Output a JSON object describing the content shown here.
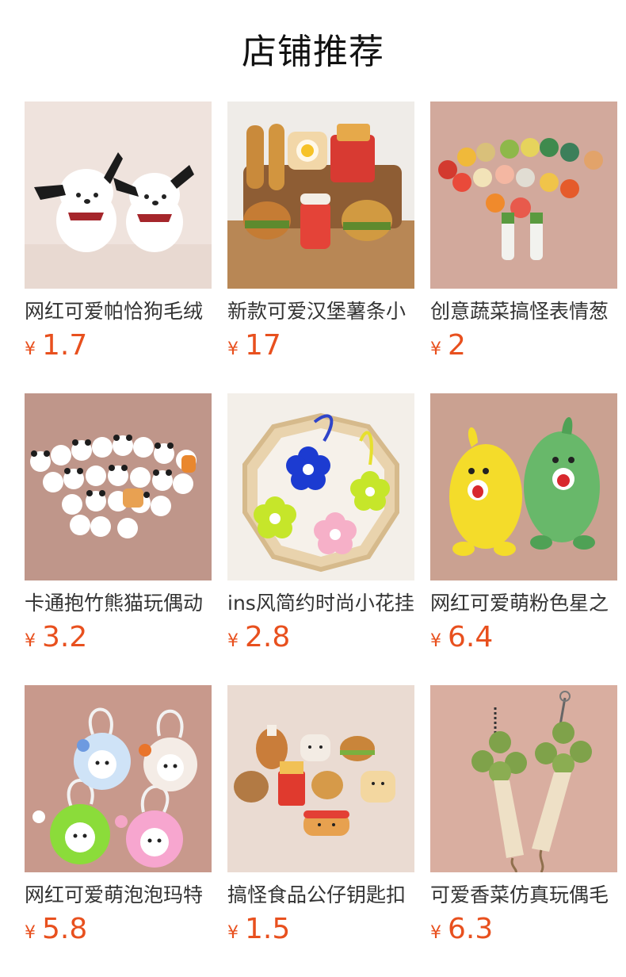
{
  "section": {
    "title": "店铺推荐"
  },
  "currency_symbol": "¥",
  "products": [
    {
      "name": "网红可爱帕恰狗毛绒",
      "price": "1.7",
      "bg": "#efe3dd",
      "image_icon": "plush-dog-pair-image"
    },
    {
      "name": "新款可爱汉堡薯条小",
      "price": "17",
      "bg": "#d9cbbd",
      "image_icon": "plush-food-bags-image"
    },
    {
      "name": "创意蔬菜搞怪表情葱",
      "price": "2",
      "bg": "#d2a99c",
      "image_icon": "plush-vegetable-keychains-image"
    },
    {
      "name": "卡通抱竹熊猫玩偶动",
      "price": "3.2",
      "bg": "#bf968a",
      "image_icon": "plush-panda-pile-image"
    },
    {
      "name": "ins风简约时尚小花挂",
      "price": "2.8",
      "bg": "#f3efe9",
      "image_icon": "flower-keychain-tray-image"
    },
    {
      "name": "网红可爱萌粉色星之",
      "price": "6.4",
      "bg": "#caa191",
      "image_icon": "plush-durian-pair-image"
    },
    {
      "name": "网红可爱萌泡泡玛特",
      "price": "5.8",
      "bg": "#c8998c",
      "image_icon": "plush-bunny-pendants-image"
    },
    {
      "name": "搞怪食品公仔钥匙扣",
      "price": "1.5",
      "bg": "#eadbd2",
      "image_icon": "plush-food-keychains-image"
    },
    {
      "name": "可爱香菜仿真玩偶毛",
      "price": "6.3",
      "bg": "#d9aea0",
      "image_icon": "plush-coriander-pendants-image"
    }
  ]
}
